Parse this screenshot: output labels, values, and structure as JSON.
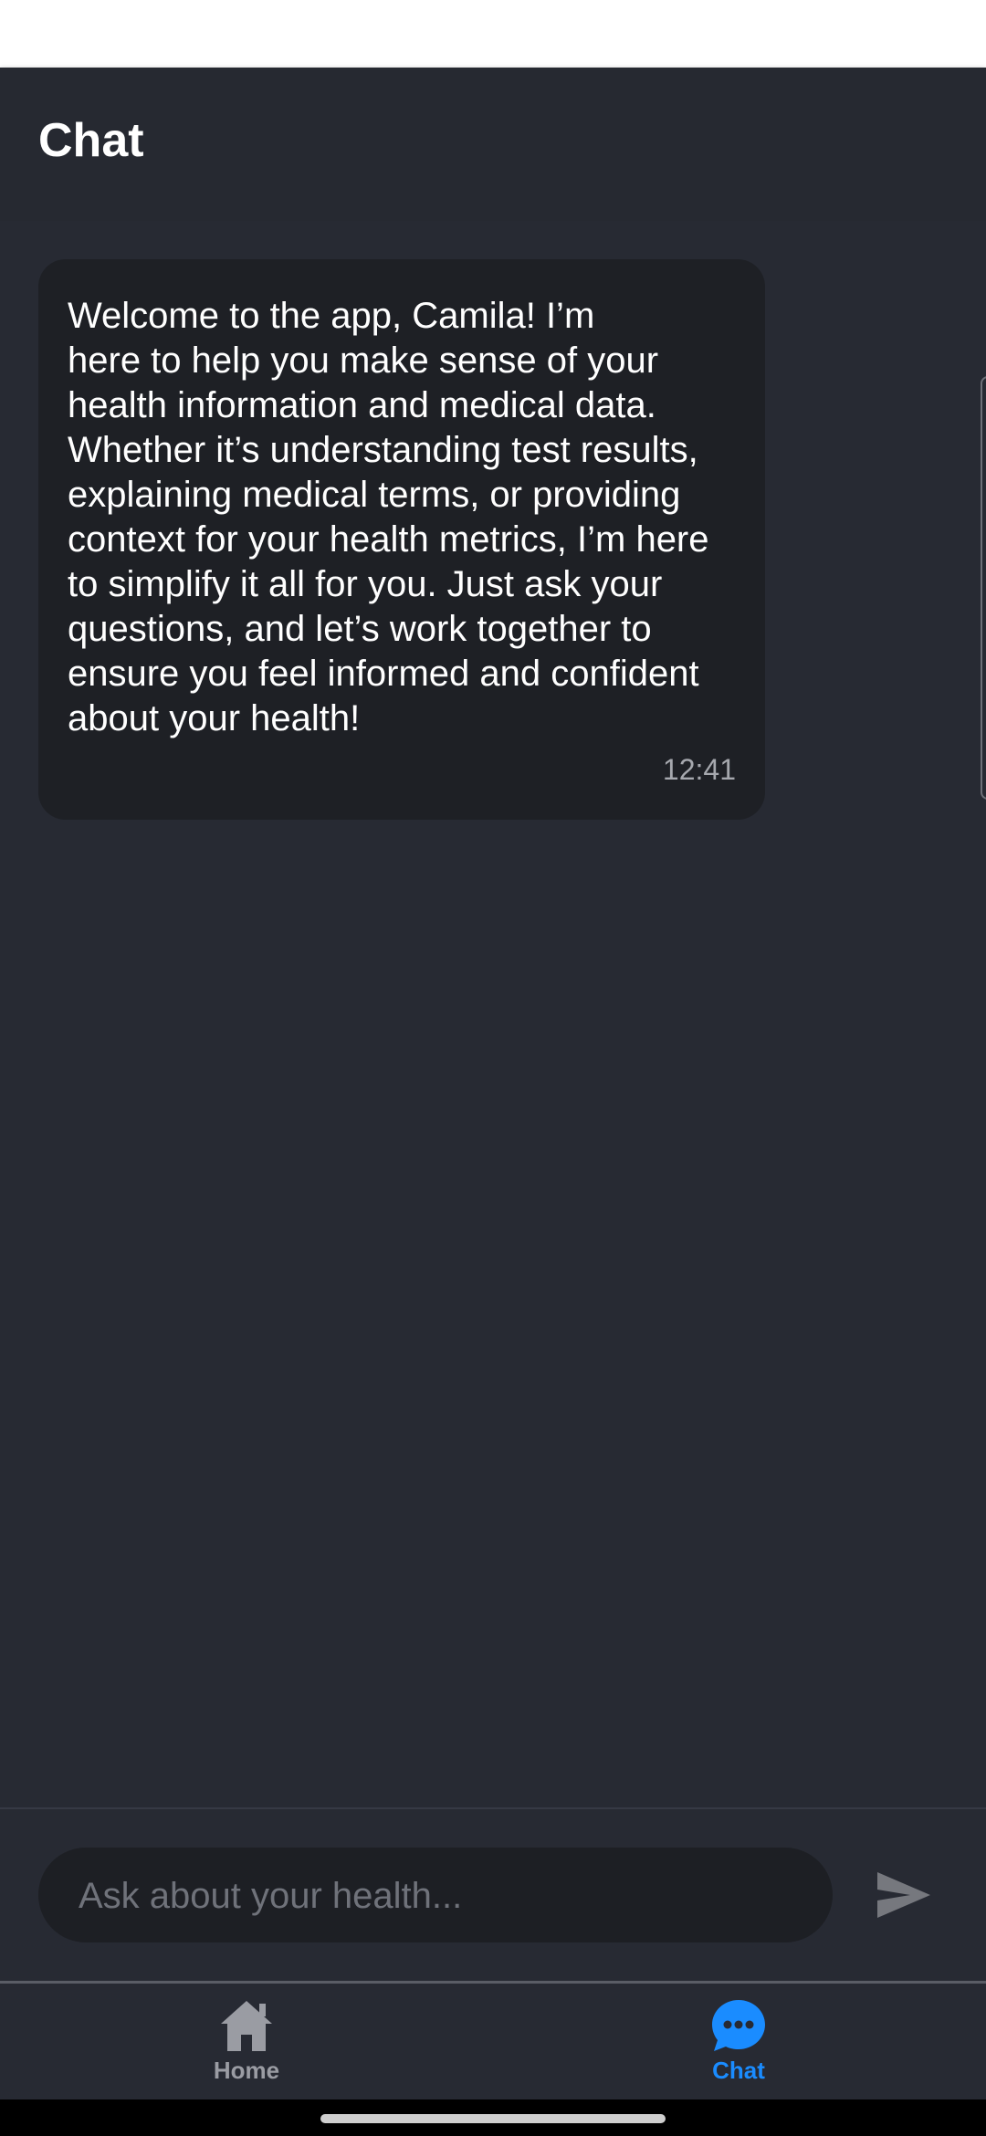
{
  "header": {
    "title": "Chat"
  },
  "messages": [
    {
      "text": "Welcome to the app, Camila! I’m\nhere to help you make sense of your\nhealth information and medical data.\nWhether it’s understanding test results,\nexplaining medical terms, or providing\ncontext for your health metrics, I’m here\nto simplify it all for you. Just ask your\nquestions, and let’s work together to\nensure you feel informed and confident\nabout your health!",
      "time": "12:41"
    }
  ],
  "composer": {
    "placeholder": "Ask about your health...",
    "value": "",
    "send_icon": "send-icon"
  },
  "bottom_nav": {
    "items": [
      {
        "label": "Home",
        "icon": "home-icon",
        "active": false
      },
      {
        "label": "Chat",
        "icon": "chat-bubble-icon",
        "active": true
      }
    ]
  },
  "colors": {
    "background": "#272a33",
    "bubble": "#1e2025",
    "accent": "#1a8cff",
    "inactive": "#9a9ca3"
  }
}
